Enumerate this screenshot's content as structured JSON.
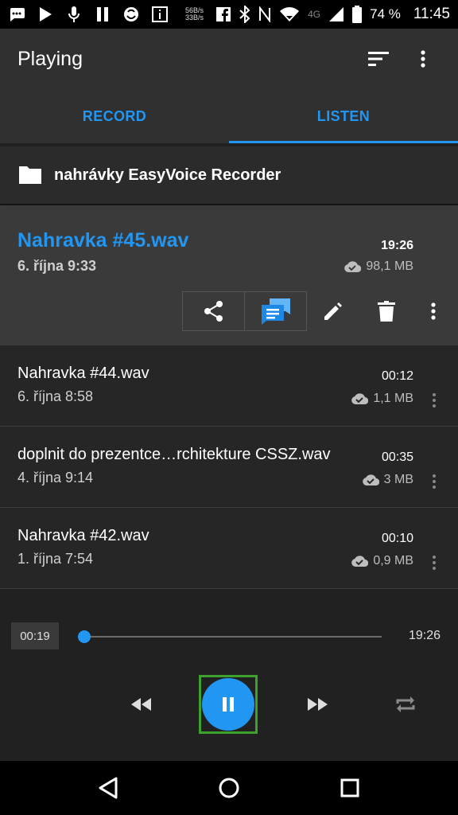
{
  "status_bar": {
    "speed_up": "56B/s",
    "speed_down": "33B/s",
    "network": "4G",
    "battery_percent": "74 %",
    "time": "11:45",
    "icons": [
      "chat-icon",
      "play-icon",
      "mic-icon",
      "pause-icon",
      "app-icon",
      "info-icon",
      "facebook-icon",
      "bluetooth-icon",
      "nfc-icon",
      "wifi-icon",
      "signal-icon",
      "battery-icon"
    ]
  },
  "app_bar": {
    "title": "Playing",
    "icons": [
      "sort-icon",
      "more-vert-icon"
    ]
  },
  "tabs": [
    {
      "label": "RECORD",
      "active": false
    },
    {
      "label": "LISTEN",
      "active": true
    }
  ],
  "folder": {
    "icon": "folder-icon",
    "name": "nahrávky EasyVoice Recorder"
  },
  "recordings": [
    {
      "name": "Nahravka #45.wav",
      "date": "6. října 9:33",
      "duration": "19:26",
      "size": "98,1 MB",
      "selected": true
    },
    {
      "name": "Nahravka #44.wav",
      "date": "6. října 8:58",
      "duration": "00:12",
      "size": "1,1 MB",
      "selected": false
    },
    {
      "name": "doplnit do prezentce…rchitekture CSSZ.wav",
      "date": "4. října 9:14",
      "duration": "00:35",
      "size": "3 MB",
      "selected": false
    },
    {
      "name": "Nahravka #42.wav",
      "date": "1. října 7:54",
      "duration": "00:10",
      "size": "0,9 MB",
      "selected": false
    }
  ],
  "selected_actions": [
    "share-icon",
    "messages-icon",
    "edit-icon",
    "delete-icon",
    "more-vert-icon"
  ],
  "player": {
    "current_time": "00:19",
    "total_time": "19:26",
    "progress": 0.016,
    "controls": [
      "rewind-icon",
      "pause-icon",
      "fast-forward-icon",
      "repeat-icon"
    ]
  },
  "colors": {
    "accent": "#2196f3",
    "background": "#212121",
    "surface": "#303030",
    "selected_row": "#3a3a3a",
    "highlight_border": "#3ea12e"
  },
  "nav_bar": {
    "icons": [
      "back-icon",
      "home-icon",
      "recents-icon"
    ]
  }
}
